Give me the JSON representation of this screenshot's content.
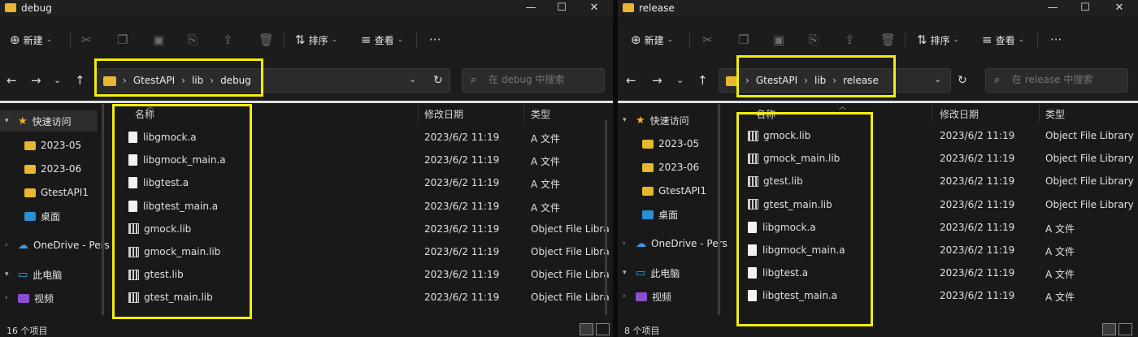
{
  "left": {
    "title": "debug",
    "toolbar": {
      "new_label": "新建",
      "sort_label": "排序",
      "view_label": "查看",
      "more": "···"
    },
    "breadcrumbs": [
      "GtestAPI",
      "lib",
      "debug"
    ],
    "search_placeholder": "在 debug 中搜索",
    "columns": {
      "name": "名称",
      "date": "修改日期",
      "type": "类型"
    },
    "files": [
      {
        "name": "libgmock.a",
        "date": "2023/6/2 11:19",
        "type": "A 文件",
        "icon": "file-icon"
      },
      {
        "name": "libgmock_main.a",
        "date": "2023/6/2 11:19",
        "type": "A 文件",
        "icon": "file-icon"
      },
      {
        "name": "libgtest.a",
        "date": "2023/6/2 11:19",
        "type": "A 文件",
        "icon": "file-icon"
      },
      {
        "name": "libgtest_main.a",
        "date": "2023/6/2 11:19",
        "type": "A 文件",
        "icon": "file-icon"
      },
      {
        "name": "gmock.lib",
        "date": "2023/6/2 11:19",
        "type": "Object File Libra",
        "icon": "library-icon"
      },
      {
        "name": "gmock_main.lib",
        "date": "2023/6/2 11:19",
        "type": "Object File Libra",
        "icon": "library-icon"
      },
      {
        "name": "gtest.lib",
        "date": "2023/6/2 11:19",
        "type": "Object File Libra",
        "icon": "library-icon"
      },
      {
        "name": "gtest_main.lib",
        "date": "2023/6/2 11:19",
        "type": "Object File Libra",
        "icon": "library-icon"
      }
    ],
    "status": "16 个项目"
  },
  "right": {
    "title": "release",
    "toolbar": {
      "new_label": "新建",
      "sort_label": "排序",
      "view_label": "查看",
      "more": "···"
    },
    "breadcrumbs": [
      "GtestAPI",
      "lib",
      "release"
    ],
    "search_placeholder": "在 release 中搜索",
    "columns": {
      "name": "名称",
      "date": "修改日期",
      "type": "类型"
    },
    "files": [
      {
        "name": "gmock.lib",
        "date": "2023/6/2 11:19",
        "type": "Object File Library",
        "icon": "library-icon"
      },
      {
        "name": "gmock_main.lib",
        "date": "2023/6/2 11:19",
        "type": "Object File Library",
        "icon": "library-icon"
      },
      {
        "name": "gtest.lib",
        "date": "2023/6/2 11:19",
        "type": "Object File Library",
        "icon": "library-icon"
      },
      {
        "name": "gtest_main.lib",
        "date": "2023/6/2 11:19",
        "type": "Object File Library",
        "icon": "library-icon"
      },
      {
        "name": "libgmock.a",
        "date": "2023/6/2 11:19",
        "type": "A 文件",
        "icon": "file-icon"
      },
      {
        "name": "libgmock_main.a",
        "date": "2023/6/2 11:19",
        "type": "A 文件",
        "icon": "file-icon"
      },
      {
        "name": "libgtest.a",
        "date": "2023/6/2 11:19",
        "type": "A 文件",
        "icon": "file-icon"
      },
      {
        "name": "libgtest_main.a",
        "date": "2023/6/2 11:19",
        "type": "A 文件",
        "icon": "file-icon"
      }
    ],
    "status": "8 个项目"
  },
  "sidebar": {
    "quick_access": "快速访问",
    "items": [
      "2023-05",
      "2023-06",
      "GtestAPI1",
      "桌面"
    ],
    "onedrive": "OneDrive - Pers",
    "this_pc": "此电脑",
    "videos": "视频"
  },
  "colors": {
    "highlight": "#f2ee0a",
    "folder": "#e8b730"
  }
}
